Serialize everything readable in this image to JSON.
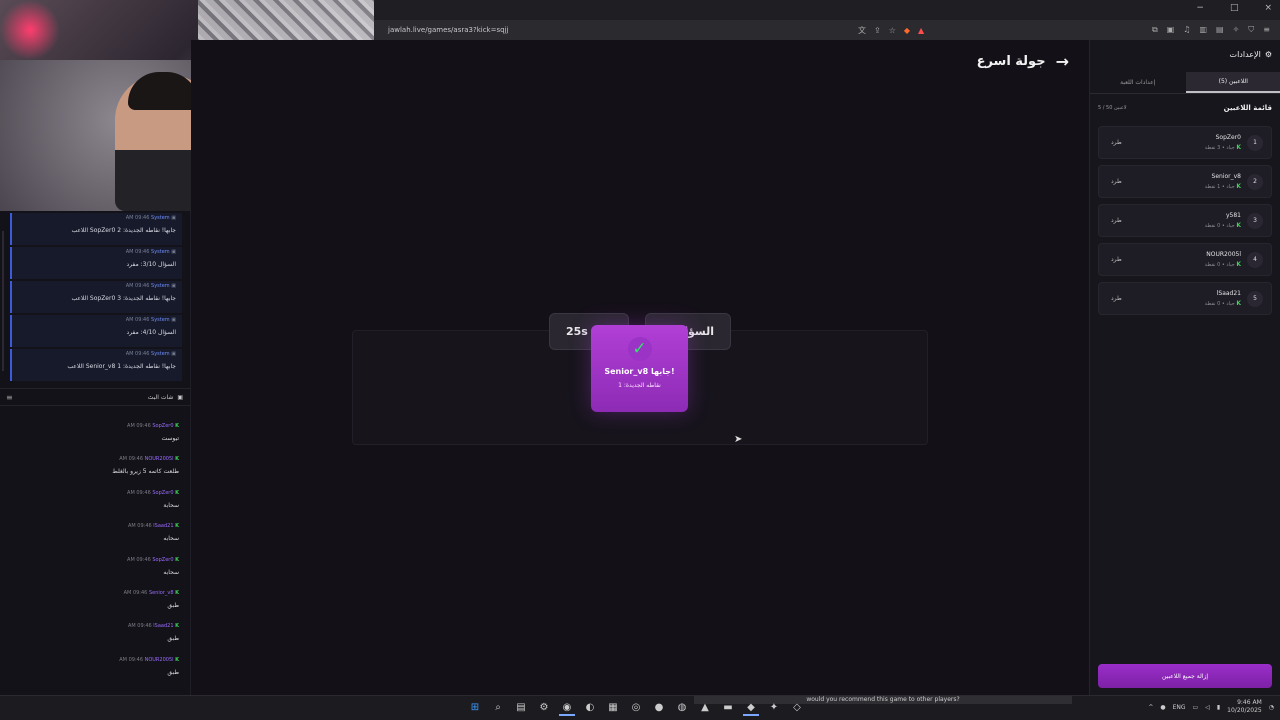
{
  "browser": {
    "url": "jawlah.live/games/asra3?kick=sqjj",
    "window_controls": [
      "−",
      "□",
      "×"
    ],
    "badge_count": "1"
  },
  "left_panel": {
    "system_messages": [
      {
        "time": "AM 09:46",
        "sender": "System",
        "text": "اللاعب SopZer0 جابها! نقاطه الجديدة: 2"
      },
      {
        "time": "AM 09:46",
        "sender": "System",
        "text": "السؤال 3/10: مفرد"
      },
      {
        "time": "AM 09:46",
        "sender": "System",
        "text": "اللاعب SopZer0 جابها! نقاطه الجديدة: 3"
      },
      {
        "time": "AM 09:46",
        "sender": "System",
        "text": "السؤال 4/10: مفرد"
      },
      {
        "time": "AM 09:46",
        "sender": "System",
        "text": "اللاعب Senior_v8 جابها! نقاطه الجديدة: 1"
      }
    ],
    "chat_title": "شات البث",
    "chat_messages": [
      {
        "time": "AM 09:46",
        "user": "SopZer0",
        "text": "تيوست"
      },
      {
        "time": "AM 09:46",
        "user": "NOUR2005l",
        "text": "طلعت كاتمه 5 زيرو بالغلط"
      },
      {
        "time": "AM 09:46",
        "user": "SopZer0",
        "text": "سحابة"
      },
      {
        "time": "AM 09:46",
        "user": "lSaad21",
        "text": "سحابه"
      },
      {
        "time": "AM 09:46",
        "user": "SopZer0",
        "text": "سحابه"
      },
      {
        "time": "AM 09:46",
        "user": "Senior_v8",
        "text": "طبق"
      },
      {
        "time": "AM 09:46",
        "user": "lSaad21",
        "text": "طبق"
      },
      {
        "time": "AM 09:46",
        "user": "NOUR2005l",
        "text": "طبق"
      }
    ]
  },
  "main": {
    "back_label": "جولة اسرع",
    "timer": "25s",
    "question_label": "السؤال",
    "popup": {
      "title": "Senior_v8 جابها!",
      "points": "نقاطه الجديدة: 1"
    }
  },
  "right_panel": {
    "title": "الإعدادات",
    "tabs": [
      {
        "label": "اللاعبين (5)",
        "active": true
      },
      {
        "label": "إعدادات اللعبة",
        "active": false
      }
    ],
    "list_title": "قائمة اللاعبين",
    "count": "5 / 50 لاعبين",
    "kick_label": "طرد",
    "players": [
      {
        "rank": "1",
        "name": "SopZer0",
        "info": "جياد • 3 نقطة"
      },
      {
        "rank": "2",
        "name": "Senior_v8",
        "info": "جياد • 1 نقطة"
      },
      {
        "rank": "3",
        "name": "y581",
        "info": "جياد • 0 نقطة"
      },
      {
        "rank": "4",
        "name": "NOUR2005l",
        "info": "جياد • 0 نقطة"
      },
      {
        "rank": "5",
        "name": "lSaad21",
        "info": "جياد • 0 نقطة"
      }
    ],
    "remove_all": "إزالة جميع اللاعبين"
  },
  "taskbar": {
    "caption": "would you recommend this game to other players?",
    "lang": "ENG",
    "time": "9:46 AM",
    "date": "10/20/2025"
  }
}
